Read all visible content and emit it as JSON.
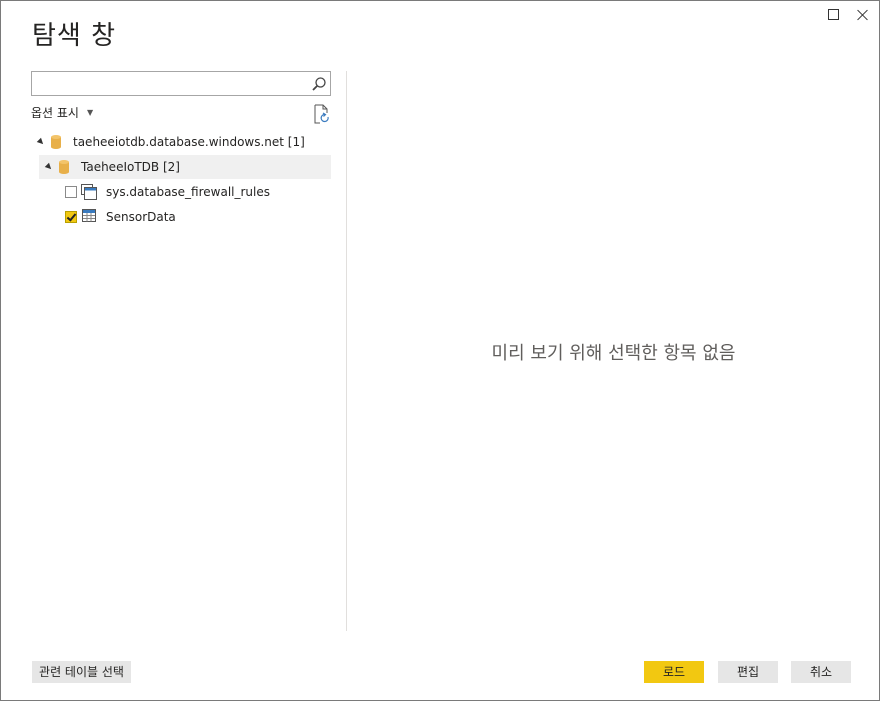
{
  "window": {
    "title": "탐색 창"
  },
  "search": {
    "value": "",
    "placeholder": ""
  },
  "options": {
    "label": "옵션 표시"
  },
  "tree": {
    "server": {
      "label": "taeheeiotdb.database.windows.net [1]"
    },
    "database": {
      "label": "TaeheeIoTDB [2]"
    },
    "items": [
      {
        "label": "sys.database_firewall_rules",
        "checked": false,
        "icon": "view-icon"
      },
      {
        "label": "SensorData",
        "checked": true,
        "icon": "table-icon"
      }
    ]
  },
  "preview": {
    "message": "미리 보기 위해 선택한 항목 없음"
  },
  "footer": {
    "related_tables_label": "관련 테이블 선택",
    "load_label": "로드",
    "edit_label": "편집",
    "cancel_label": "취소"
  },
  "colors": {
    "accent": "#f2c811",
    "selected_row": "#f0f0f0",
    "db_icon": "#e8b04a"
  }
}
